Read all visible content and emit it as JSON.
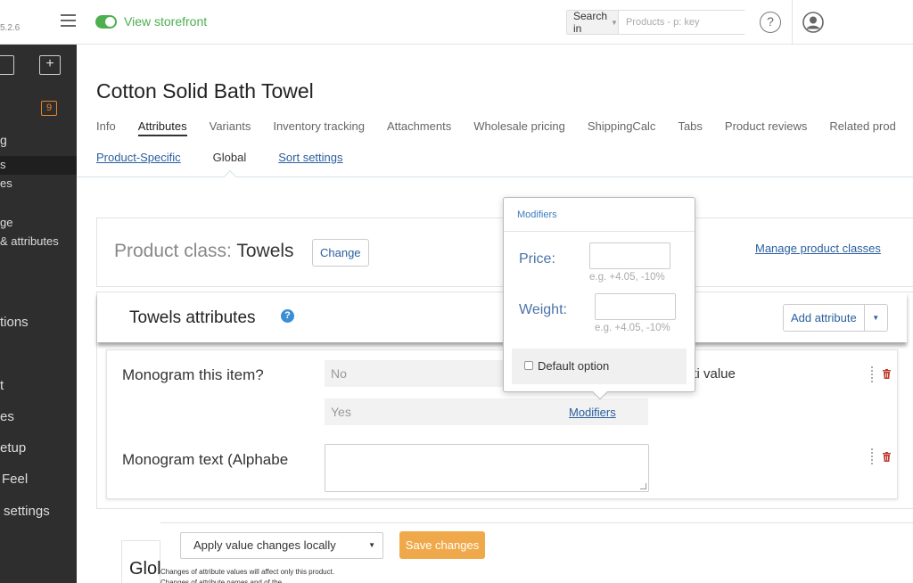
{
  "app": {
    "version": "5.2.6"
  },
  "header": {
    "storefront_label": "View storefront",
    "search_in_label": "Search in",
    "search_placeholder": "Products - p: key",
    "help_label": "?"
  },
  "sidebar": {
    "tools": [
      "",
      "+"
    ],
    "badge_count": "9",
    "items": [
      "g",
      "s",
      "es",
      "ge",
      "& attributes",
      "tions",
      "t",
      "es",
      "etup",
      "Feel",
      "settings"
    ]
  },
  "product": {
    "title": "Cotton Solid Bath Towel"
  },
  "tabs": [
    {
      "label": "Info"
    },
    {
      "label": "Attributes"
    },
    {
      "label": "Variants"
    },
    {
      "label": "Inventory tracking"
    },
    {
      "label": "Attachments"
    },
    {
      "label": "Wholesale pricing"
    },
    {
      "label": "ShippingCalc"
    },
    {
      "label": "Tabs"
    },
    {
      "label": "Product reviews"
    },
    {
      "label": "Related prod"
    }
  ],
  "subtabs": [
    {
      "label": "Product-Specific"
    },
    {
      "label": "Global"
    },
    {
      "label": "Sort settings"
    }
  ],
  "product_class": {
    "label": "Product class:",
    "value": "Towels",
    "change_label": "Change",
    "manage_label": "Manage product classes"
  },
  "attributes": {
    "title": "Towels attributes",
    "info_icon_label": "?",
    "add_label": "Add attribute",
    "rows": [
      {
        "label": "Monogram this item?",
        "values": [
          "No",
          "Yes"
        ],
        "modifiers_label": "Modifiers",
        "type_label": "lti value"
      },
      {
        "label": "Monogram text (Alphabe"
      }
    ]
  },
  "popover": {
    "title": "Modifiers",
    "price_label": "Price:",
    "price_hint": "e.g. +4.05, -10%",
    "weight_label": "Weight:",
    "weight_hint": "e.g. +4.05, -10%",
    "default_option_label": "Default option"
  },
  "footer": {
    "apply_select_value": "Apply value changes locally",
    "save_label": "Save changes",
    "note": "Changes of attribute values will affect only this product. Changes of attribute names and of the"
  },
  "global_panel": {
    "title": "Glol"
  }
}
